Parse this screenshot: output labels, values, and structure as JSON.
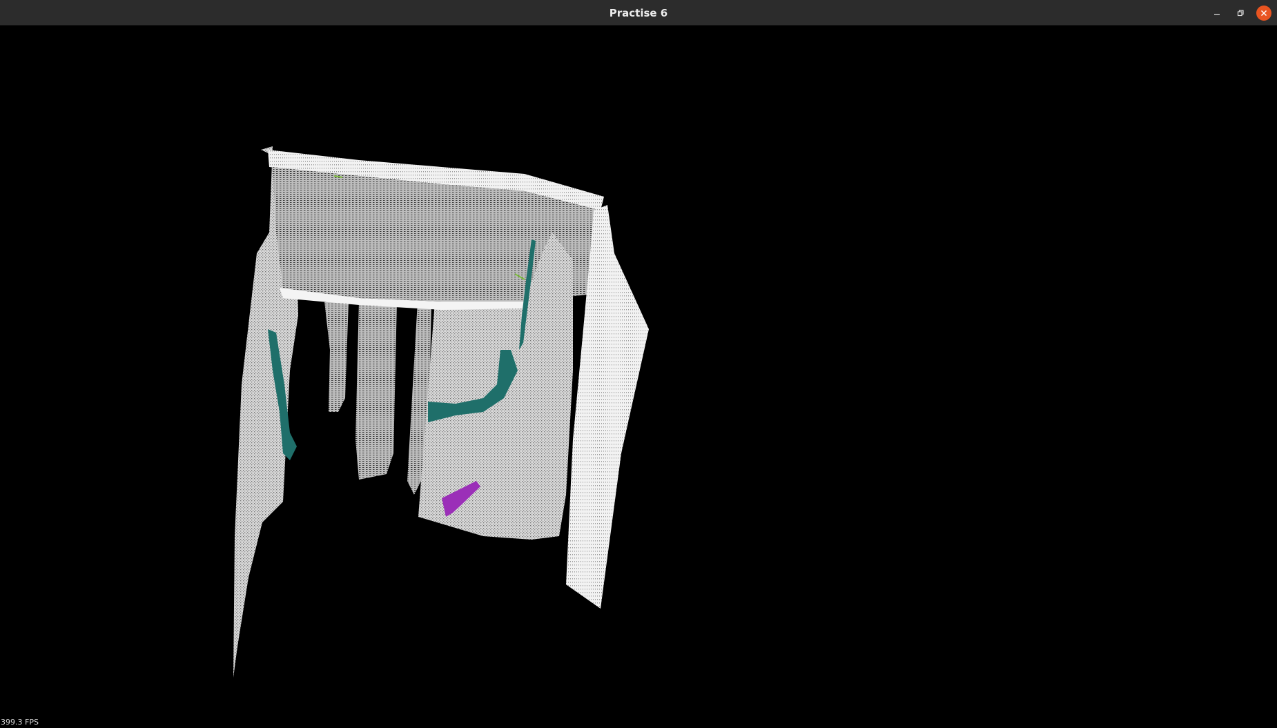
{
  "window": {
    "title": "Practise 6"
  },
  "controls": {
    "minimize_icon": "minimize-icon",
    "maximize_icon": "restore-icon",
    "close_icon": "close-icon",
    "close_color": "#e95420"
  },
  "viewport": {
    "background": "#000000",
    "fps": "399.3 FPS"
  },
  "point_cloud": {
    "point_color": "#ffffff",
    "segment_colors": [
      "#1f6f6a",
      "#9b2fb8",
      "#7fbf3f"
    ]
  }
}
